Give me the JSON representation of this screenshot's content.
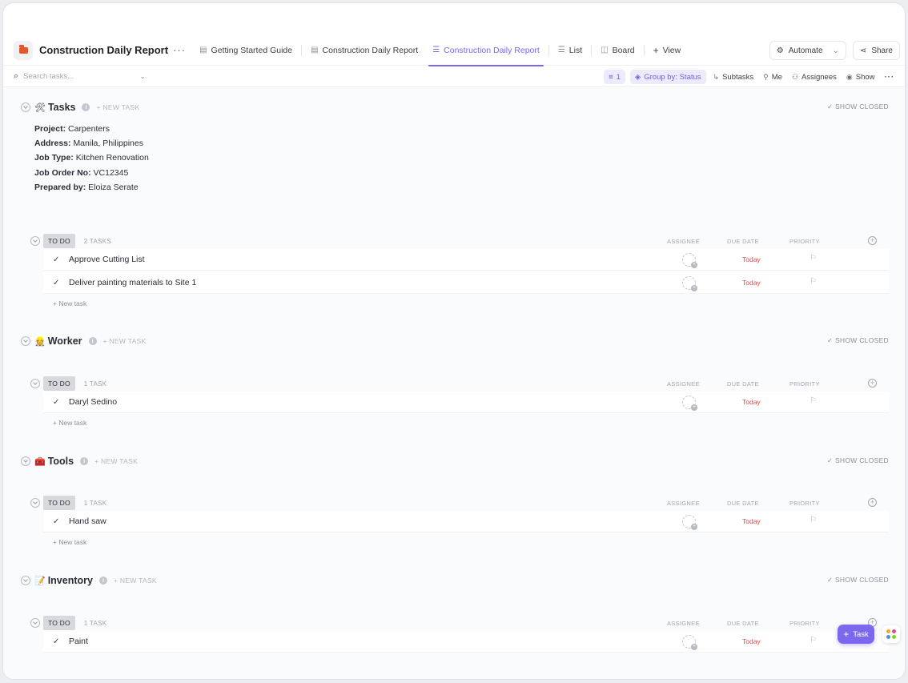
{
  "header": {
    "title": "Construction Daily Report",
    "more": "···",
    "tabs": [
      {
        "label": "Getting Started Guide",
        "icon": "doc-icon"
      },
      {
        "label": "Construction Daily Report",
        "icon": "doc-icon"
      },
      {
        "label": "Construction Daily Report",
        "icon": "list-view-icon",
        "active": true
      },
      {
        "label": "List",
        "icon": "list-icon"
      },
      {
        "label": "Board",
        "icon": "board-icon"
      }
    ],
    "add_view": "View",
    "automate": "Automate",
    "share": "Share"
  },
  "toolbar": {
    "search_placeholder": "Search tasks...",
    "filter_count": "1",
    "group_by": "Group by: Status",
    "subtasks": "Subtasks",
    "me": "Me",
    "assignees": "Assignees",
    "show": "Show"
  },
  "columns": {
    "assignee": "ASSIGNEE",
    "due_date": "DUE DATE",
    "priority": "PRIORITY"
  },
  "common": {
    "new_task_header": "+ NEW TASK",
    "show_closed": "SHOW CLOSED",
    "add_task": "+ New task",
    "status": "TO DO"
  },
  "sections": [
    {
      "name": "Tasks",
      "emoji": "🛠",
      "description": [
        {
          "label": "Project:",
          "value": "Carpenters"
        },
        {
          "label": "Address:",
          "value": "Manila, Philippines"
        },
        {
          "label": "Job Type:",
          "value": "Kitchen Renovation"
        },
        {
          "label": "Job Order No:",
          "value": "VC12345"
        },
        {
          "label": "Prepared by:",
          "value": " Eloiza Serate"
        }
      ],
      "count": "2 TASKS",
      "tasks": [
        {
          "name": "Approve Cutting List",
          "due": "Today"
        },
        {
          "name": "Deliver painting materials to Site 1",
          "due": "Today"
        }
      ]
    },
    {
      "name": "Worker",
      "emoji": "👷",
      "count": "1 TASK",
      "tasks": [
        {
          "name": "Daryl Sedino",
          "due": "Today"
        }
      ]
    },
    {
      "name": "Tools",
      "emoji": "🧰",
      "count": "1 TASK",
      "tasks": [
        {
          "name": "Hand saw",
          "due": "Today"
        }
      ]
    },
    {
      "name": "Inventory",
      "emoji": "📝",
      "count": "1 TASK",
      "tasks": [
        {
          "name": "Paint",
          "due": "Today"
        }
      ]
    }
  ],
  "fab": {
    "label": "Task"
  },
  "colors": {
    "accent": "#7b68ee",
    "overdue": "#e04a4a",
    "brand_space": "#e2572b"
  }
}
